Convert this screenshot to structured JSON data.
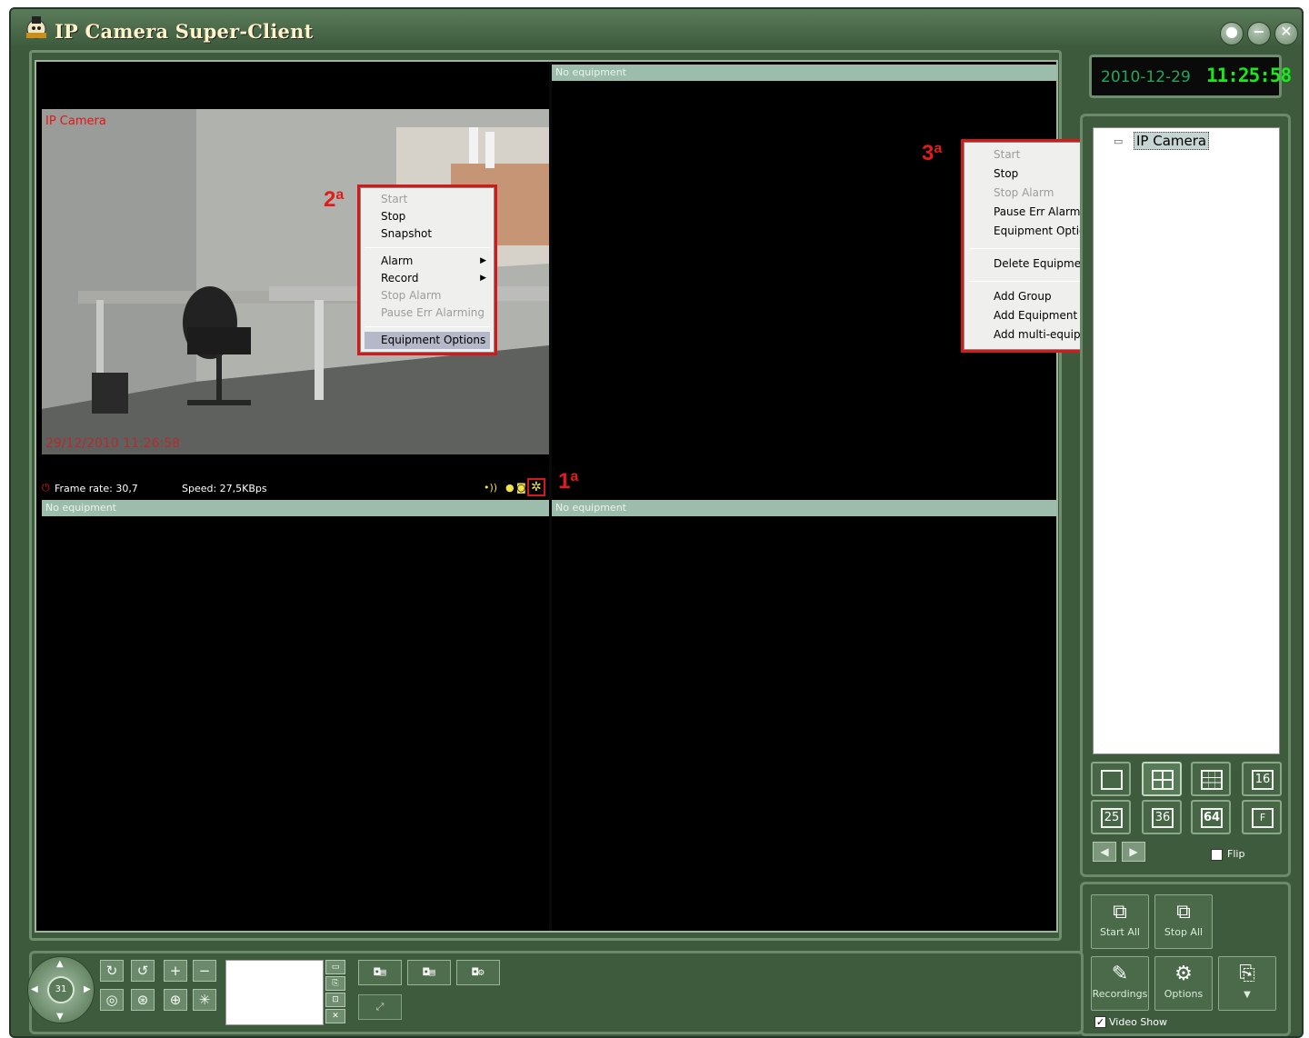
{
  "window": {
    "title": "IP Camera Super-Client",
    "controls": [
      "●",
      "−",
      "✕"
    ]
  },
  "video": {
    "panels": [
      {
        "label": "No equipment"
      },
      {
        "label": "No equipment"
      },
      {
        "label": "No equipment"
      }
    ],
    "camera": {
      "name": "IP Camera",
      "timestamp": "29/12/2010 11:26:58",
      "frame_rate": "Frame rate: 30,7",
      "speed": "Speed: 27,5KBps"
    }
  },
  "callouts": {
    "one": "1",
    "two": "2",
    "three": "3",
    "sup": "a"
  },
  "menu_camera": {
    "items": [
      {
        "label": "Start",
        "disabled": true
      },
      {
        "label": "Stop"
      },
      {
        "label": "Snapshot"
      },
      {
        "label": "Alarm",
        "submenu": true
      },
      {
        "label": "Record",
        "submenu": true
      },
      {
        "label": "Stop Alarm",
        "disabled": true
      },
      {
        "label": "Pause Err Alarming",
        "disabled": true
      },
      {
        "label": "Equipment Options",
        "highlighted": true
      }
    ]
  },
  "menu_tree": {
    "items": [
      {
        "label": "Start",
        "disabled": true
      },
      {
        "label": "Stop"
      },
      {
        "label": "Stop Alarm",
        "disabled": true
      },
      {
        "label": "Pause Err Alarming"
      },
      {
        "label": "Equipment Options"
      },
      {
        "label": "Delete Equipment"
      },
      {
        "label": "Add Group"
      },
      {
        "label": "Add Equipment"
      },
      {
        "label": "Add multi-equipments"
      }
    ]
  },
  "clock": {
    "date": "2010-12-29",
    "time": "11:25:58"
  },
  "tree": {
    "node": "IP Camera"
  },
  "layout_buttons": [
    "",
    "",
    "",
    "16",
    "25",
    "36",
    "64",
    "F"
  ],
  "flip": {
    "label": "Flip",
    "checked": false
  },
  "actions": {
    "start_all": "Start All",
    "stop_all": "Stop All",
    "recordings": "Recordings",
    "options": "Options"
  },
  "video_show": {
    "label": "Video Show",
    "checked": true
  },
  "ptz": {
    "center_label": "31"
  },
  "colors": {
    "frame_green": "#3d5a3d",
    "accent_red": "#d21a1a",
    "clock_green": "#19e81a"
  }
}
